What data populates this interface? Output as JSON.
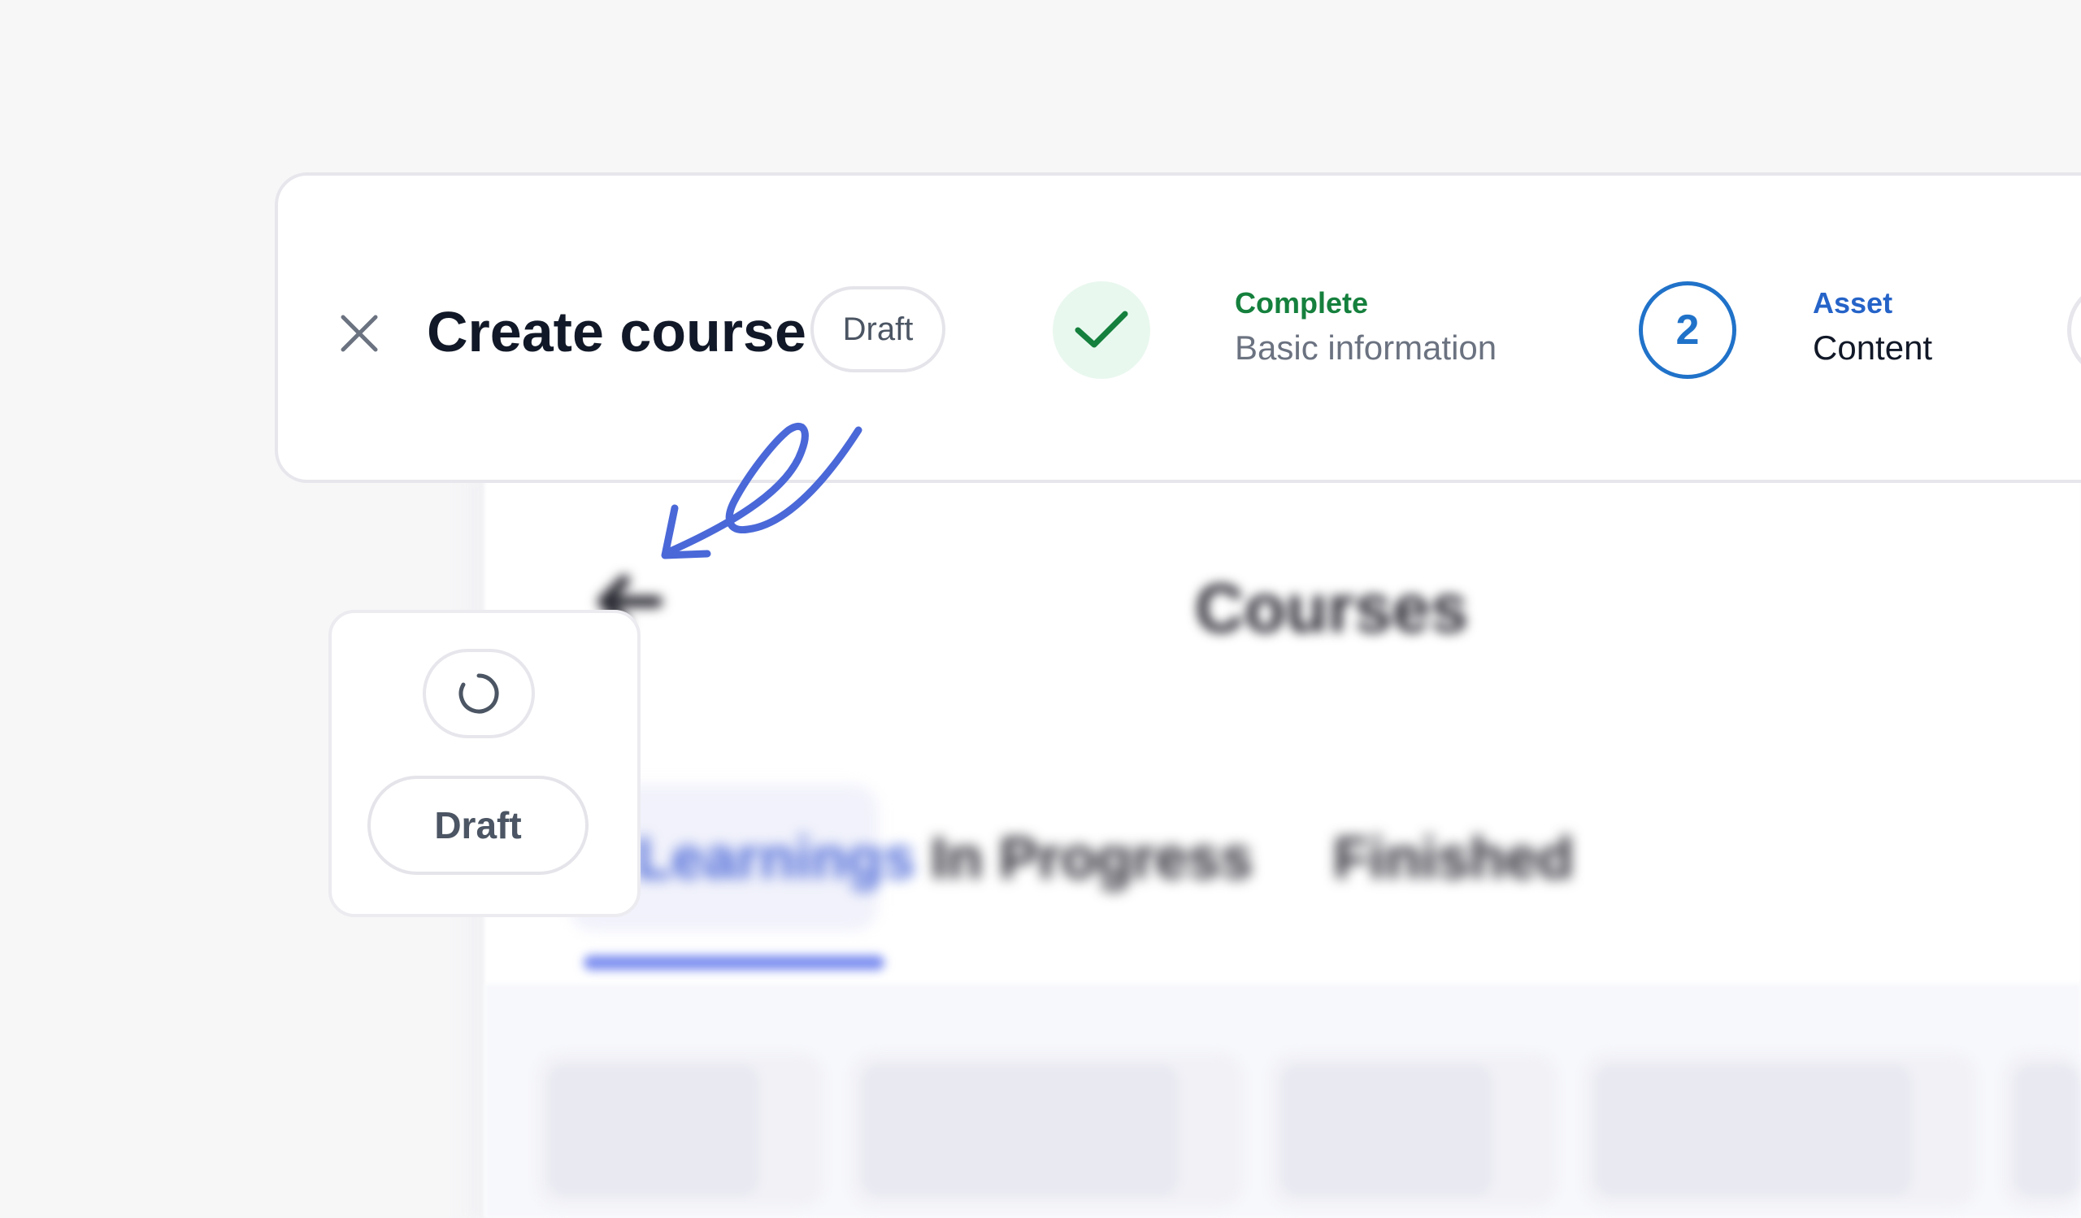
{
  "header": {
    "title": "Create course",
    "status_badge": "Draft",
    "close_icon": "close-icon"
  },
  "steps": [
    {
      "status": "Complete",
      "label": "Basic information",
      "icon": "check-icon",
      "state": "complete",
      "color": "#15803d"
    },
    {
      "number": "2",
      "status": "Asset",
      "label": "Content",
      "state": "active",
      "color": "#2072c9"
    },
    {
      "state": "upcoming"
    }
  ],
  "widget": {
    "spinner_icon": "loading-spinner-icon",
    "draft_button_label": "Draft"
  },
  "annotation": {
    "icon": "hand-drawn-arrow-icon",
    "color": "#4a68d8"
  },
  "background_page": {
    "title": "Courses",
    "back_icon": "arrow-left-icon",
    "tabs": [
      {
        "label": "Learnings",
        "active": true
      },
      {
        "label": "In Progress",
        "active": false
      },
      {
        "label": "Finished",
        "active": false
      }
    ],
    "accent_color": "#4f6bd8"
  }
}
